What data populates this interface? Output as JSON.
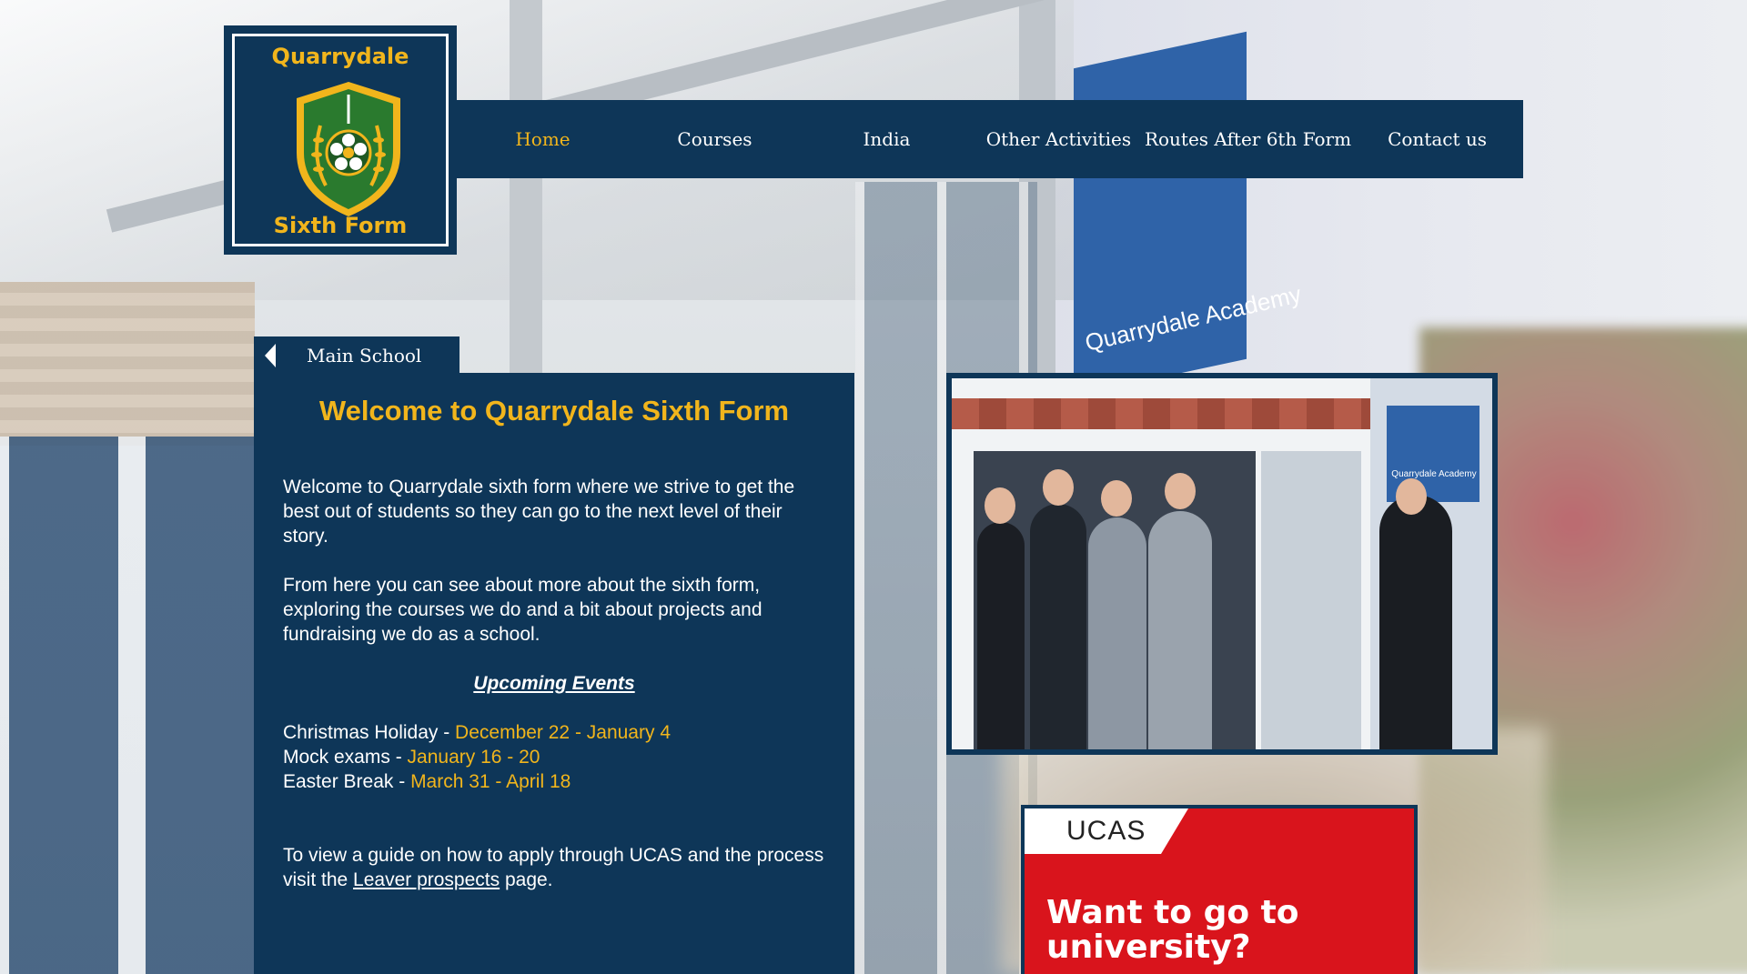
{
  "background": {
    "sign_text": "Quarrydale Academy"
  },
  "logo": {
    "top_text": "Quarrydale",
    "bottom_text": "Sixth Form"
  },
  "nav": {
    "items": [
      {
        "label": "Home",
        "active": true
      },
      {
        "label": "Courses",
        "active": false
      },
      {
        "label": "India",
        "active": false
      },
      {
        "label": "Other Activities",
        "active": false
      },
      {
        "label": "Routes After 6th Form",
        "active": false
      },
      {
        "label": "Contact us",
        "active": false
      }
    ]
  },
  "main_school_tab": {
    "label": "Main School"
  },
  "welcome": {
    "title": "Welcome to Quarrydale Sixth Form",
    "paragraph1": "Welcome to Quarrydale sixth form where we strive to get the best out of students so they can go to the next level of their story.",
    "paragraph2": "From here you can see about more about the sixth form, exploring the courses we do and a bit about projects and fundraising we do as a school.",
    "events_title": "Upcoming Events",
    "events": [
      {
        "name": "Christmas Holiday - ",
        "date": "December 22 - January 4"
      },
      {
        "name": "Mock exams - ",
        "date": "January 16 - 20"
      },
      {
        "name": "Easter Break - ",
        "date": "March 31 - April 18"
      }
    ],
    "ucas_text_before": "To view a guide on how to apply through UCAS and the process visit the ",
    "ucas_link": "Leaver prospects",
    "ucas_text_after": " page."
  },
  "photo": {
    "plate_text": "Quarrydale Academy"
  },
  "ucas_ad": {
    "logo": "UCAS",
    "headline": "Want to go to university?"
  },
  "colors": {
    "navy": "#0e3658",
    "gold": "#f1b51c",
    "ucas_red": "#d9141c"
  }
}
